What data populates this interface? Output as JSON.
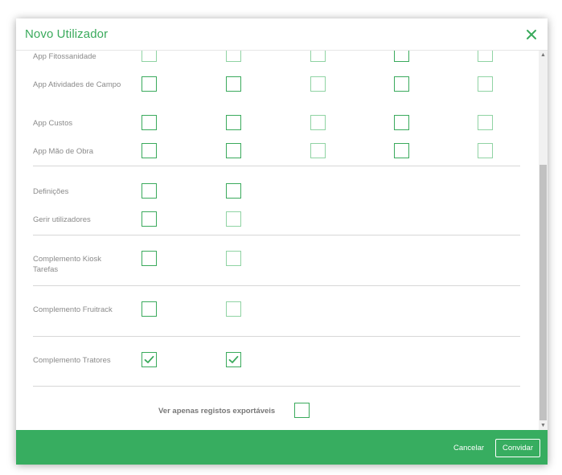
{
  "modal": {
    "title": "Novo Utilizador",
    "close_icon": "close-x-icon"
  },
  "permissions": {
    "group_apps": [
      {
        "label": "App Fitossanidade",
        "checked": [
          false,
          false,
          false,
          false,
          false
        ]
      },
      {
        "label": "App Atividades de Campo",
        "checked": [
          false,
          false,
          false,
          false,
          false
        ]
      },
      {
        "label": "App Custos",
        "checked": [
          false,
          false,
          false,
          false,
          false
        ]
      },
      {
        "label": "App Mão de Obra",
        "checked": [
          false,
          false,
          false,
          false,
          false
        ]
      }
    ],
    "group_settings": [
      {
        "label": "Definições",
        "checked": [
          false,
          false
        ]
      },
      {
        "label": "Gerir utilizadores",
        "checked": [
          false,
          false
        ]
      }
    ],
    "kiosk": {
      "label": "Complemento Kiosk Tarefas",
      "checked": [
        false,
        false
      ]
    },
    "fruitrack": {
      "label": "Complemento Fruitrack",
      "checked": [
        false,
        false
      ]
    },
    "tractors": {
      "label": "Complemento Tratores",
      "checked": [
        true,
        true
      ]
    }
  },
  "export_only": {
    "label": "Ver apenas registos exportáveis",
    "checked": false
  },
  "footer": {
    "cancel_label": "Cancelar",
    "invite_label": "Convidar"
  },
  "colors": {
    "accent": "#3aaa5c",
    "footer": "#37ad60"
  },
  "icons": {
    "check": "check-icon",
    "scroll_up": "scroll-up-arrow-icon",
    "scroll_down": "scroll-down-arrow-icon"
  }
}
